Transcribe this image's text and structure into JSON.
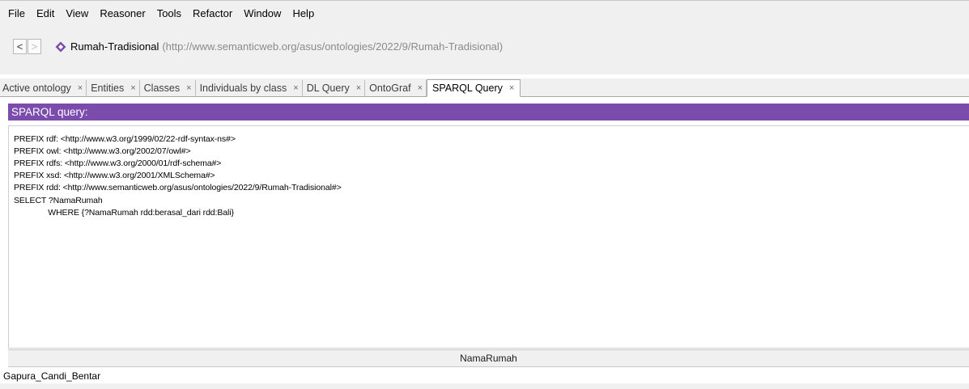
{
  "menubar": {
    "items": [
      "File",
      "Edit",
      "View",
      "Reasoner",
      "Tools",
      "Refactor",
      "Window",
      "Help"
    ]
  },
  "navbar": {
    "back_label": "<",
    "forward_label": ">",
    "ontology_name": "Rumah-Tradisional",
    "ontology_iri": "(http://www.semanticweb.org/asus/ontologies/2022/9/Rumah-Tradisional)",
    "icon": "ontology-diamond-icon",
    "icon_color": "#7b4cab"
  },
  "tabs": [
    {
      "label": "Active ontology",
      "close": "×"
    },
    {
      "label": "Entities",
      "close": "×"
    },
    {
      "label": "Classes",
      "close": "×"
    },
    {
      "label": "Individuals by class",
      "close": "×"
    },
    {
      "label": "DL Query",
      "close": "×"
    },
    {
      "label": "OntoGraf",
      "close": "×"
    },
    {
      "label": "SPARQL Query",
      "close": "×",
      "active": true
    }
  ],
  "query_panel": {
    "header": "SPARQL query:",
    "header_color": "#7b4cab",
    "lines": [
      "PREFIX rdf: <http://www.w3.org/1999/02/22-rdf-syntax-ns#>",
      "PREFIX owl: <http://www.w3.org/2002/07/owl#>",
      "PREFIX rdfs: <http://www.w3.org/2000/01/rdf-schema#>",
      "PREFIX xsd: <http://www.w3.org/2001/XMLSchema#>",
      "PREFIX rdd: <http://www.semanticweb.org/asus/ontologies/2022/9/Rumah-Tradisional#>",
      "SELECT ?NamaRumah",
      "               WHERE {?NamaRumah rdd:berasal_dari rdd:Bali}"
    ]
  },
  "results": {
    "columns": [
      "NamaRumah"
    ],
    "rows": [
      [
        "Gapura_Candi_Bentar"
      ]
    ]
  }
}
